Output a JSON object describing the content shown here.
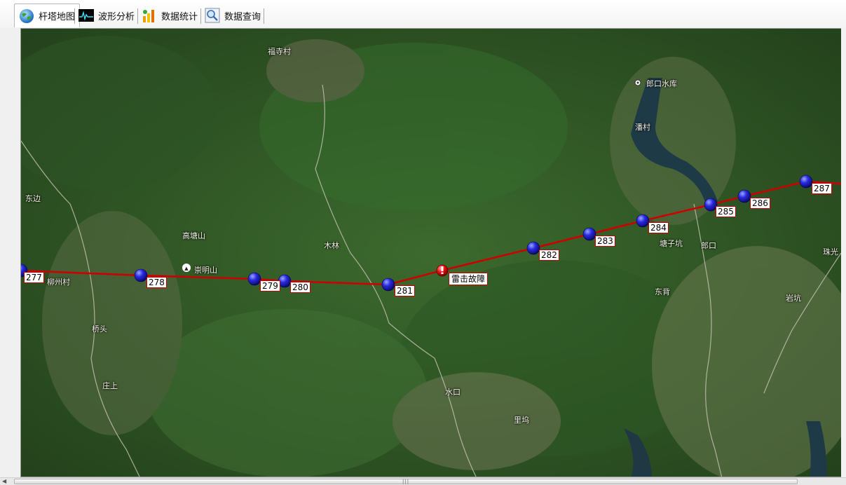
{
  "tabs": [
    {
      "label": "杆塔地图",
      "icon": "globe-icon"
    },
    {
      "label": "波形分析",
      "icon": "waveform-icon"
    },
    {
      "label": "数据统计",
      "icon": "bar-chart-icon"
    },
    {
      "label": "数据查询",
      "icon": "magnifier-icon"
    }
  ],
  "map": {
    "places": [
      {
        "name": "福寺村"
      },
      {
        "name": "郎口水库"
      },
      {
        "name": "潘村"
      },
      {
        "name": "东边"
      },
      {
        "name": "高塘山"
      },
      {
        "name": "木林"
      },
      {
        "name": "崇明山"
      },
      {
        "name": "柳州村"
      },
      {
        "name": "桥头"
      },
      {
        "name": "庄上"
      },
      {
        "name": "水口"
      },
      {
        "name": "里坞"
      },
      {
        "name": "塘子坑"
      },
      {
        "name": "郎口"
      },
      {
        "name": "东背"
      },
      {
        "name": "岩坑"
      },
      {
        "name": "珠光"
      }
    ],
    "towers": [
      "277",
      "278",
      "279",
      "280",
      "281",
      "282",
      "283",
      "284",
      "285",
      "286",
      "287"
    ],
    "fault": {
      "label": "雷击故障"
    },
    "line_color": "#cc0000",
    "tower_color": "#1a1acc"
  },
  "scrollbar": {
    "grip": "|||"
  }
}
